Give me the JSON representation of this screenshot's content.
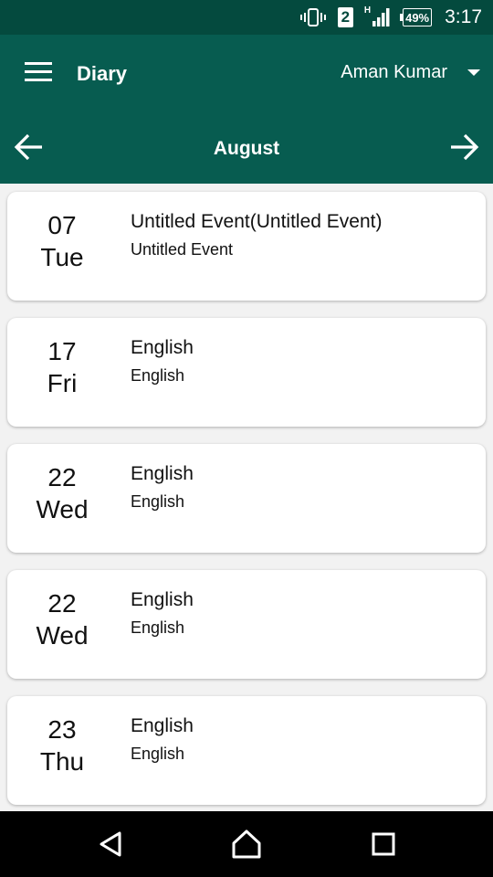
{
  "status_bar": {
    "sim_slot": "2",
    "network_type": "H",
    "battery": "49%",
    "time": "3:17",
    "icons": [
      "vibrate-icon",
      "sim-icon",
      "signal-icon",
      "battery-icon"
    ]
  },
  "app_bar": {
    "title": "Diary",
    "user_name": "Aman Kumar",
    "month": "August",
    "icons": [
      "menu-icon",
      "chevron-down-icon",
      "arrow-left-icon",
      "arrow-right-icon"
    ]
  },
  "events": [
    {
      "day": "07",
      "weekday": "Tue",
      "title": "Untitled Event(Untitled Event)",
      "subtitle": "Untitled Event"
    },
    {
      "day": "17",
      "weekday": "Fri",
      "title": "English",
      "subtitle": "English"
    },
    {
      "day": "22",
      "weekday": "Wed",
      "title": "English",
      "subtitle": "English"
    },
    {
      "day": "22",
      "weekday": "Wed",
      "title": "English",
      "subtitle": "English"
    },
    {
      "day": "23",
      "weekday": "Thu",
      "title": "English",
      "subtitle": "English"
    }
  ],
  "nav_bar": {
    "icons": [
      "back-icon",
      "home-icon",
      "recents-icon"
    ]
  },
  "colors": {
    "status_bar": "#044a3e",
    "app_bar": "#075c50",
    "background": "#f2f2f2",
    "card": "#ffffff",
    "nav_bar": "#000000"
  }
}
